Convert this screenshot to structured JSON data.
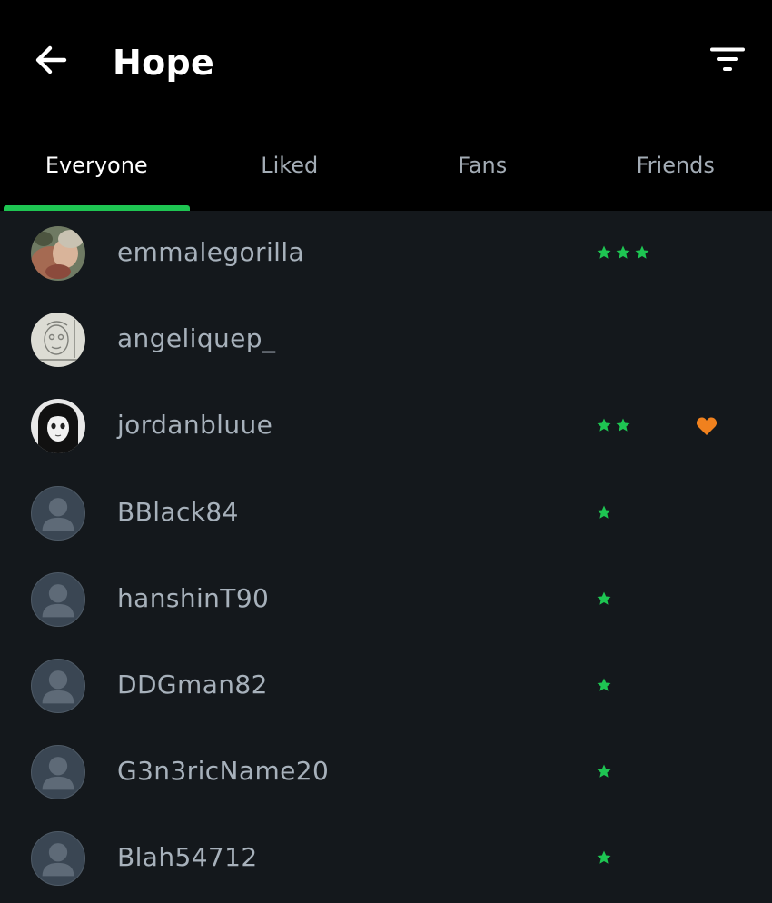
{
  "header": {
    "title": "Hope",
    "back_icon": "arrow-left-icon",
    "filter_icon": "filter-icon"
  },
  "tabs": [
    {
      "label": "Everyone",
      "active": true
    },
    {
      "label": "Liked",
      "active": false
    },
    {
      "label": "Fans",
      "active": false
    },
    {
      "label": "Friends",
      "active": false
    }
  ],
  "colors": {
    "accent": "#1ec552",
    "star": "#1ec552",
    "like": "#f0811e",
    "background": "#14181c",
    "header": "#000000"
  },
  "members": [
    {
      "username": "emmalegorilla",
      "stars": 3,
      "liked": false,
      "avatar": "photo-1"
    },
    {
      "username": "angeliquep_",
      "stars": 0,
      "liked": false,
      "avatar": "photo-2"
    },
    {
      "username": "jordanbluue",
      "stars": 2,
      "liked": true,
      "avatar": "photo-3"
    },
    {
      "username": "BBlack84",
      "stars": 1,
      "liked": false,
      "avatar": "default"
    },
    {
      "username": "hanshinT90",
      "stars": 1,
      "liked": false,
      "avatar": "default"
    },
    {
      "username": "DDGman82",
      "stars": 1,
      "liked": false,
      "avatar": "default"
    },
    {
      "username": "G3n3ricName20",
      "stars": 1,
      "liked": false,
      "avatar": "default"
    },
    {
      "username": "Blah54712",
      "stars": 1,
      "liked": false,
      "avatar": "default"
    }
  ]
}
